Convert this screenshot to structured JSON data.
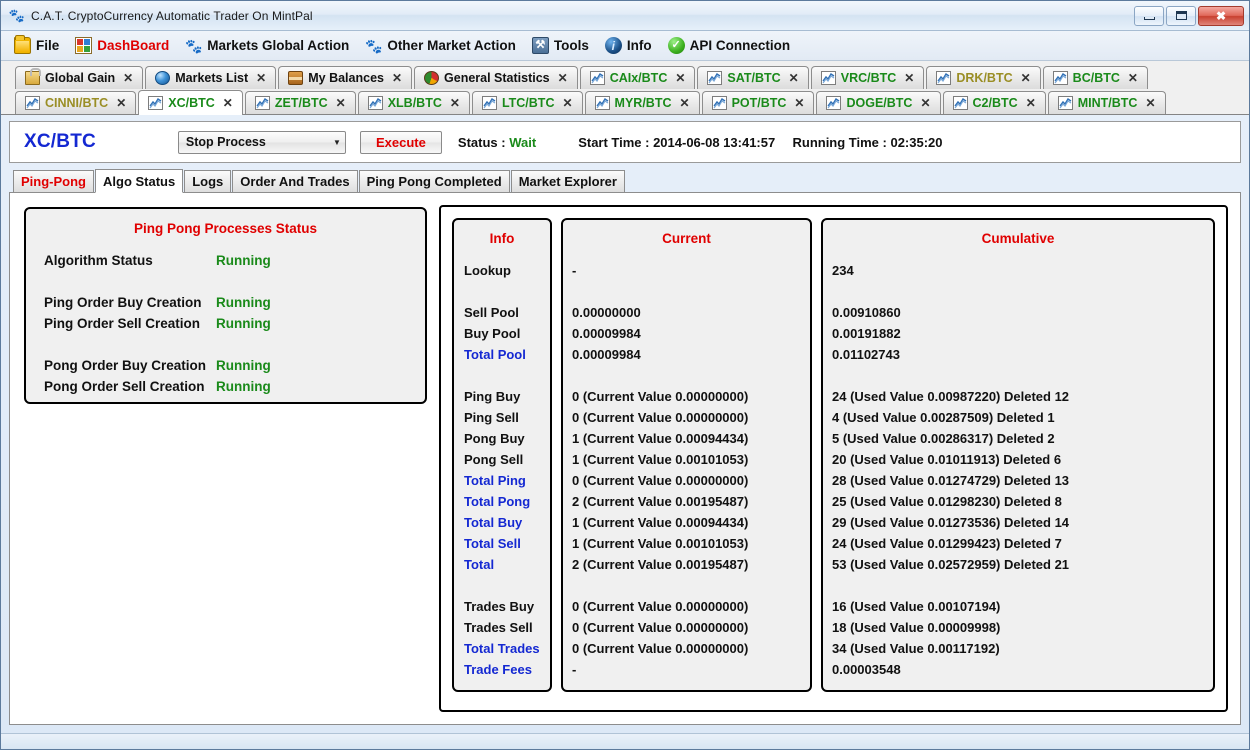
{
  "window": {
    "title": "C.A.T. CryptoCurrency Automatic Trader On MintPal",
    "app_icon": "paw-icon",
    "minimize": "–",
    "maximize": "□",
    "close": "✕"
  },
  "menu": {
    "items": [
      {
        "label": "File",
        "icon": "folder-icon",
        "color": "black"
      },
      {
        "label": "DashBoard",
        "icon": "dashboard-icon",
        "color": "red"
      },
      {
        "label": "Markets Global Action",
        "icon": "paw-icon",
        "color": "black"
      },
      {
        "label": "Other Market Action",
        "icon": "paw-icon",
        "color": "black"
      },
      {
        "label": "Tools",
        "icon": "tools-icon",
        "color": "black"
      },
      {
        "label": "Info",
        "icon": "info-icon",
        "color": "black"
      },
      {
        "label": "API Connection",
        "icon": "check-circle-icon",
        "color": "black"
      }
    ]
  },
  "tabs_row1": [
    {
      "label": "Global Gain",
      "icon": "lock-icon",
      "color": "black",
      "active": false,
      "close": "✕"
    },
    {
      "label": "Markets List",
      "icon": "globe-icon",
      "color": "black",
      "active": false,
      "close": "✕"
    },
    {
      "label": "My Balances",
      "icon": "box-icon",
      "color": "black",
      "active": false,
      "close": "✕"
    },
    {
      "label": "General Statistics",
      "icon": "pie-icon",
      "color": "black",
      "active": false,
      "close": "✕"
    },
    {
      "label": "CAIx/BTC",
      "icon": "chart-icon",
      "color": "green",
      "active": false,
      "close": "✕"
    },
    {
      "label": "SAT/BTC",
      "icon": "chart-icon",
      "color": "green",
      "active": false,
      "close": "✕"
    },
    {
      "label": "VRC/BTC",
      "icon": "chart-icon",
      "color": "green",
      "active": false,
      "close": "✕"
    },
    {
      "label": "DRK/BTC",
      "icon": "chart-icon",
      "color": "olive",
      "active": false,
      "close": "✕"
    },
    {
      "label": "BC/BTC",
      "icon": "chart-icon",
      "color": "green",
      "active": false,
      "close": "✕"
    }
  ],
  "tabs_row2": [
    {
      "label": "CINNI/BTC",
      "icon": "chart-icon",
      "color": "olive",
      "active": false,
      "close": "✕"
    },
    {
      "label": "XC/BTC",
      "icon": "chart-icon",
      "color": "green",
      "active": true,
      "close": "✕"
    },
    {
      "label": "ZET/BTC",
      "icon": "chart-icon",
      "color": "green",
      "active": false,
      "close": "✕"
    },
    {
      "label": "XLB/BTC",
      "icon": "chart-icon",
      "color": "green",
      "active": false,
      "close": "✕"
    },
    {
      "label": "LTC/BTC",
      "icon": "chart-icon",
      "color": "green",
      "active": false,
      "close": "✕"
    },
    {
      "label": "MYR/BTC",
      "icon": "chart-icon",
      "color": "green",
      "active": false,
      "close": "✕"
    },
    {
      "label": "POT/BTC",
      "icon": "chart-icon",
      "color": "green",
      "active": false,
      "close": "✕"
    },
    {
      "label": "DOGE/BTC",
      "icon": "chart-icon",
      "color": "green",
      "active": false,
      "close": "✕"
    },
    {
      "label": "C2/BTC",
      "icon": "chart-icon",
      "color": "green",
      "active": false,
      "close": "✕"
    },
    {
      "label": "MINT/BTC",
      "icon": "chart-icon",
      "color": "green",
      "active": false,
      "close": "✕"
    }
  ],
  "market_bar": {
    "title": "XC/BTC",
    "process_select": "Stop Process",
    "caret": "▼",
    "execute_label": "Execute",
    "status_label": "Status :",
    "status_value": "Wait",
    "start_time_label": "Start Time : 2014-06-08 13:41:57",
    "running_time_label": "Running Time : 02:35:20"
  },
  "inner_tabs": [
    {
      "label": "Ping-Pong",
      "color": "red",
      "active": false
    },
    {
      "label": "Algo Status",
      "color": "black",
      "active": true
    },
    {
      "label": "Logs",
      "color": "black",
      "active": false
    },
    {
      "label": "Order And Trades",
      "color": "black",
      "active": false
    },
    {
      "label": "Ping Pong Completed",
      "color": "black",
      "active": false
    },
    {
      "label": "Market Explorer",
      "color": "black",
      "active": false
    }
  ],
  "ping_pong_status": {
    "title": "Ping Pong Processes Status",
    "rows": [
      {
        "label": "Algorithm Status",
        "value": "Running"
      },
      {
        "label": "",
        "value": ""
      },
      {
        "label": "Ping Order Buy Creation",
        "value": "Running"
      },
      {
        "label": "Ping Order Sell Creation",
        "value": "Running"
      },
      {
        "label": "",
        "value": ""
      },
      {
        "label": "Pong Order Buy Creation",
        "value": "Running"
      },
      {
        "label": "Pong Order Sell Creation",
        "value": "Running"
      }
    ]
  },
  "algo_table": {
    "headers": {
      "info": "Info",
      "current": "Current",
      "cumulative": "Cumulative"
    },
    "rows": [
      {
        "info": "Lookup",
        "info_color": "black",
        "current": "-",
        "cumulative": "234"
      },
      {
        "info": "",
        "info_color": "black",
        "current": "",
        "cumulative": ""
      },
      {
        "info": "Sell Pool",
        "info_color": "black",
        "current": "0.00000000",
        "cumulative": "0.00910860"
      },
      {
        "info": "Buy Pool",
        "info_color": "black",
        "current": "0.00009984",
        "cumulative": "0.00191882"
      },
      {
        "info": "Total Pool",
        "info_color": "blue",
        "current": "0.00009984",
        "cumulative": "0.01102743"
      },
      {
        "info": "",
        "info_color": "black",
        "current": "",
        "cumulative": ""
      },
      {
        "info": "Ping Buy",
        "info_color": "black",
        "current": "0 (Current Value 0.00000000)",
        "cumulative": "24 (Used Value 0.00987220) Deleted 12"
      },
      {
        "info": "Ping Sell",
        "info_color": "black",
        "current": "0 (Current Value 0.00000000)",
        "cumulative": "4 (Used Value 0.00287509) Deleted 1"
      },
      {
        "info": "Pong Buy",
        "info_color": "black",
        "current": "1 (Current Value 0.00094434)",
        "cumulative": "5 (Used Value 0.00286317) Deleted 2"
      },
      {
        "info": "Pong Sell",
        "info_color": "black",
        "current": "1 (Current Value 0.00101053)",
        "cumulative": "20 (Used Value 0.01011913) Deleted 6"
      },
      {
        "info": "Total Ping",
        "info_color": "blue",
        "current": "0 (Current Value 0.00000000)",
        "cumulative": "28 (Used Value 0.01274729) Deleted 13"
      },
      {
        "info": "Total Pong",
        "info_color": "blue",
        "current": "2 (Current Value 0.00195487)",
        "cumulative": "25 (Used Value 0.01298230) Deleted 8"
      },
      {
        "info": "Total Buy",
        "info_color": "blue",
        "current": "1 (Current Value 0.00094434)",
        "cumulative": "29 (Used Value 0.01273536) Deleted 14"
      },
      {
        "info": "Total Sell",
        "info_color": "blue",
        "current": "1 (Current Value 0.00101053)",
        "cumulative": "24 (Used Value 0.01299423) Deleted 7"
      },
      {
        "info": "Total",
        "info_color": "blue",
        "current": "2 (Current Value 0.00195487)",
        "cumulative": "53 (Used Value 0.02572959) Deleted 21"
      },
      {
        "info": "",
        "info_color": "black",
        "current": "",
        "cumulative": ""
      },
      {
        "info": "Trades Buy",
        "info_color": "black",
        "current": "0 (Current Value 0.00000000)",
        "cumulative": "16 (Used Value 0.00107194)"
      },
      {
        "info": "Trades Sell",
        "info_color": "black",
        "current": "0 (Current Value 0.00000000)",
        "cumulative": "18 (Used Value 0.00009998)"
      },
      {
        "info": "Total Trades",
        "info_color": "blue",
        "current": "0 (Current Value 0.00000000)",
        "cumulative": "34 (Used Value 0.00117192)"
      },
      {
        "info": "Trade Fees",
        "info_color": "blue",
        "current": "-",
        "cumulative": "0.00003548"
      }
    ]
  },
  "colors": {
    "accent_red": "#e00000",
    "accent_blue": "#1428d2",
    "accent_green": "#1a8a1a",
    "accent_olive": "#9a8e25"
  }
}
